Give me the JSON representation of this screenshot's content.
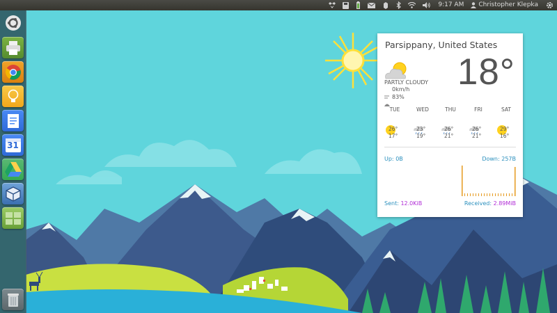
{
  "panel": {
    "time": "9:17 AM",
    "user": "Christopher Klepka",
    "indicators": [
      "dropbox-icon",
      "save-icon",
      "battery-icon",
      "mail-icon",
      "network-icon",
      "bluetooth-icon",
      "wifi-icon",
      "volume-icon"
    ]
  },
  "launcher": {
    "items": [
      {
        "name": "ubuntu-dash",
        "icon": "ubuntu-logo-icon"
      },
      {
        "name": "file-manager",
        "icon": "printer-icon"
      },
      {
        "name": "chrome",
        "icon": "chrome-icon"
      },
      {
        "name": "keep",
        "icon": "lightbulb-icon"
      },
      {
        "name": "docs",
        "icon": "document-icon"
      },
      {
        "name": "calendar",
        "icon": "calendar-icon",
        "text": "31"
      },
      {
        "name": "drive",
        "icon": "drive-icon"
      },
      {
        "name": "virtualbox",
        "icon": "virtualbox-icon"
      },
      {
        "name": "workspaces",
        "icon": "workspace-switcher-icon"
      },
      {
        "name": "trash",
        "icon": "trash-icon"
      }
    ]
  },
  "weather": {
    "location": "Parsippany, United States",
    "temperature": "18°",
    "condition": "PARTLY CLOUDY",
    "wind": "0km/h",
    "humidity": "83%",
    "forecast": [
      {
        "day": "TUE",
        "high": "26°",
        "low": "17°"
      },
      {
        "day": "WED",
        "high": "23°",
        "low": "19°"
      },
      {
        "day": "THU",
        "high": "26°",
        "low": "21°"
      },
      {
        "day": "FRI",
        "high": "26°",
        "low": "21°"
      },
      {
        "day": "SAT",
        "high": "29°",
        "low": "16°"
      }
    ]
  },
  "network": {
    "up_label": "Up:",
    "up_value": "0B",
    "down_label": "Down:",
    "down_value": "257B",
    "sent_label": "Sent:",
    "sent_value": "12.0KiB",
    "received_label": "Received:",
    "received_value": "2.89MiB"
  },
  "colors": {
    "sky": "#5fd5dc",
    "mountain": "#3d5a8c",
    "meadow": "#c9e041",
    "water": "#2ab0d8",
    "sun": "#ffe03a",
    "net_accent": "#2a8fbd",
    "net_value": "#b02bd6",
    "graph_bar": "#e69a1f"
  }
}
